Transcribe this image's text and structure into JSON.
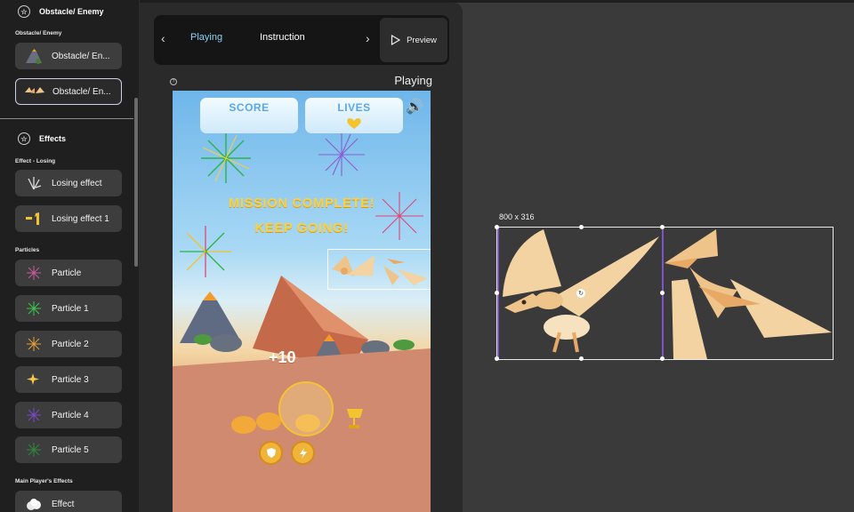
{
  "sidebar": {
    "section_obstacle": {
      "title": "Obstacle/ Enemy",
      "sub": "Obstacle/ Enemy"
    },
    "obstacle_items": [
      {
        "label": "Obstacle/ En..."
      },
      {
        "label": "Obstacle/ En..."
      }
    ],
    "section_effects": {
      "title": "Effects"
    },
    "effect_losing": {
      "sub": "Effect - Losing",
      "items": [
        {
          "label": "Losing effect"
        },
        {
          "label": "Losing effect 1"
        }
      ]
    },
    "particles": {
      "sub": "Particles",
      "items": [
        {
          "label": "Particle"
        },
        {
          "label": "Particle 1"
        },
        {
          "label": "Particle 2"
        },
        {
          "label": "Particle 3"
        },
        {
          "label": "Particle 4"
        },
        {
          "label": "Particle 5"
        }
      ]
    },
    "main_player": {
      "sub": "Main Player's Effects",
      "items": [
        {
          "label": "Effect"
        }
      ]
    }
  },
  "center": {
    "tabs": [
      {
        "label": "Playing"
      },
      {
        "label": "Instruction"
      }
    ],
    "active_tab": "Playing",
    "preview_label": "Preview",
    "screen_title": "Playing",
    "game": {
      "score_label": "SCORE",
      "lives_label": "LIVES",
      "message_line1": "MISSION COMPLETE!",
      "message_line2": "KEEP GOING!",
      "score_popup": "+10"
    }
  },
  "canvas": {
    "size_label": "800 x 316"
  },
  "colors": {
    "accent": "#8fd0f5",
    "frame_divider": "#7d55c7",
    "sky": "#6fb6ea",
    "ground": "#cf8a6f",
    "gold": "#f6d24a"
  }
}
